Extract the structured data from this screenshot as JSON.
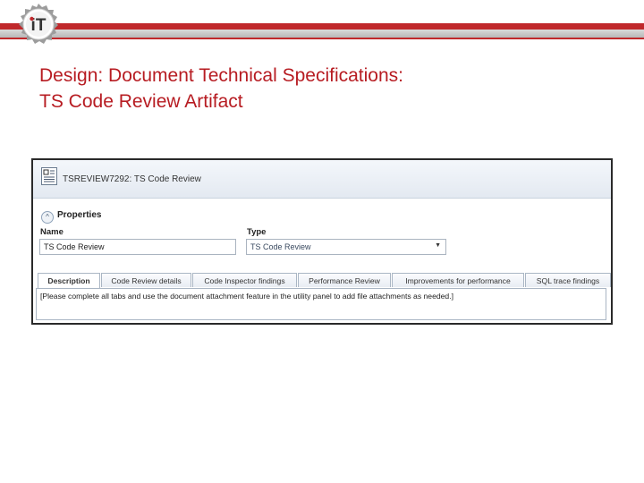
{
  "slide": {
    "title_line1": "Design: Document Technical Specifications:",
    "title_line2": "TS Code Review Artifact",
    "logo_text": "iT",
    "colors": {
      "brand_red": "#c0282b",
      "title_red": "#b71c22"
    }
  },
  "screenshot": {
    "header_title": "TSREVIEW7292: TS Code Review",
    "header_icon": "document-icon",
    "properties_label": "Properties",
    "fields": {
      "name_label": "Name",
      "name_value": "TS Code Review",
      "type_label": "Type",
      "type_value": "TS Code Review"
    },
    "tabs": [
      {
        "label": "Description",
        "active": true
      },
      {
        "label": "Code Review details",
        "active": false
      },
      {
        "label": "Code Inspector findings",
        "active": false
      },
      {
        "label": "Performance Review",
        "active": false
      },
      {
        "label": "Improvements for performance",
        "active": false
      },
      {
        "label": "SQL trace findings",
        "active": false
      }
    ],
    "content_text": "[Please complete all tabs and use the document attachment feature in the utility panel to add file attachments as needed.]"
  }
}
